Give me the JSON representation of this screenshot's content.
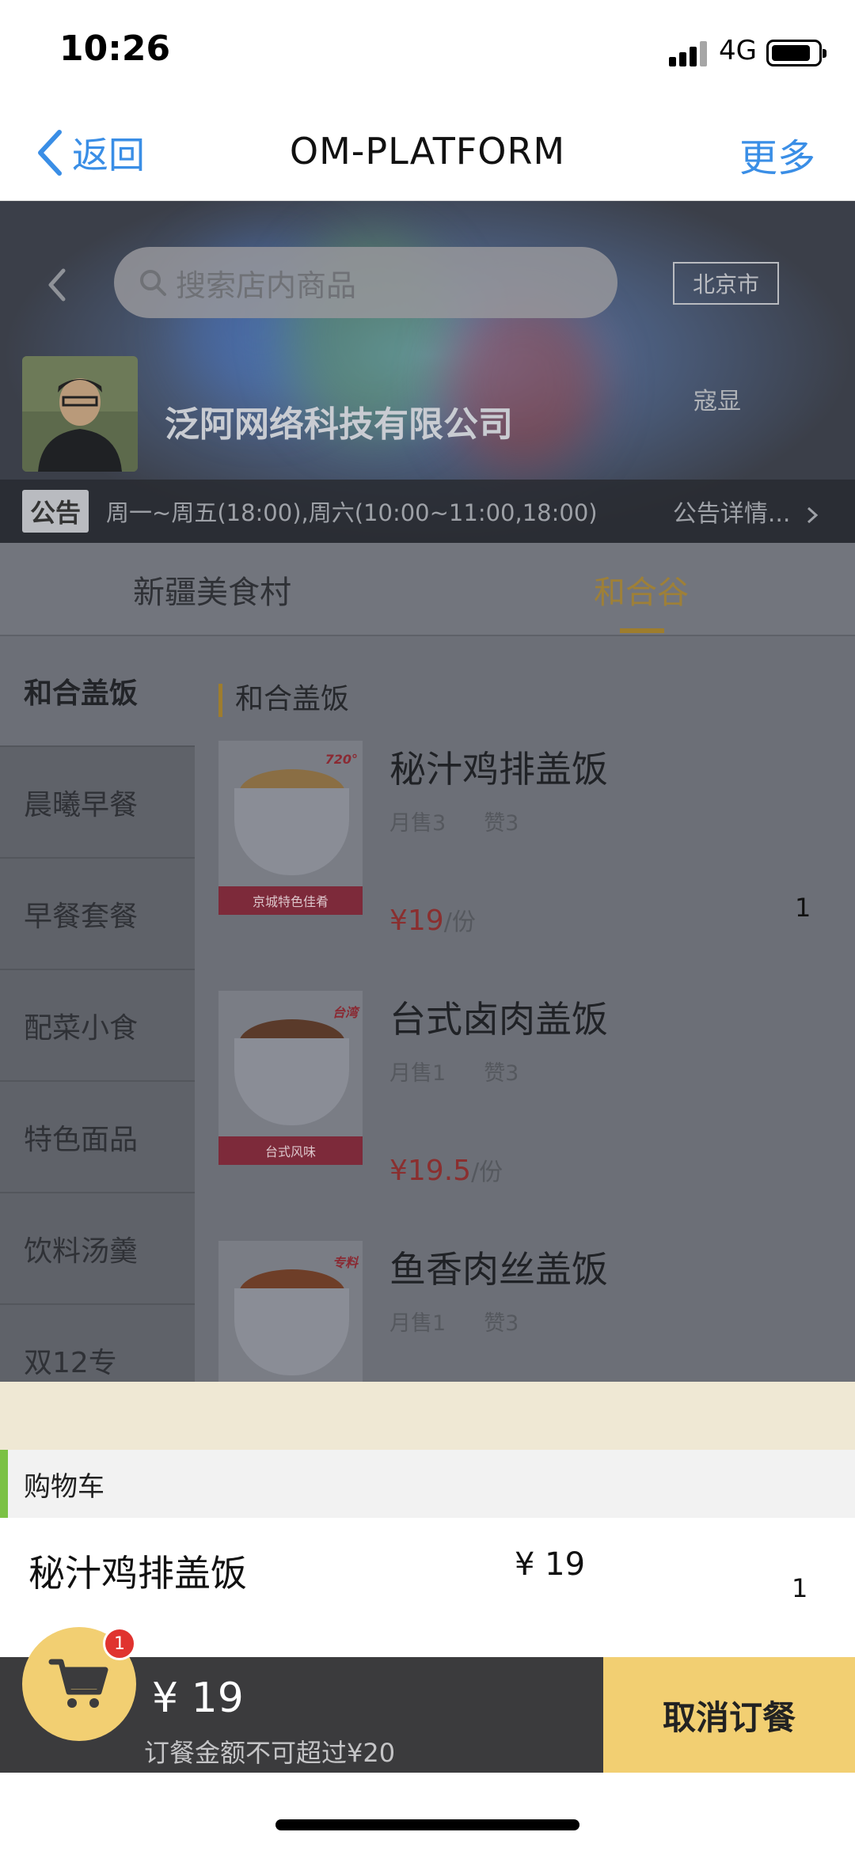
{
  "status_bar": {
    "time": "10:26",
    "network": "4G",
    "icons": [
      "signal-icon",
      "battery-icon"
    ]
  },
  "nav": {
    "back_label": "返回",
    "title": "OM-PLATFORM",
    "more_label": "更多",
    "icons": [
      "back-chevron-icon"
    ]
  },
  "shop": {
    "search_placeholder": "搜索店内商品",
    "city": "北京市",
    "name": "泛阿网络科技有限公司",
    "owner": "寇显",
    "notice_tag": "公告",
    "notice_text": "周一~周五(18:00),周六(10:00~11:00,18:00)",
    "notice_more": "公告详情...",
    "icons": [
      "back-chevron-icon",
      "search-icon",
      "chevron-right-icon",
      "avatar-photo"
    ]
  },
  "tabs": [
    {
      "label": "新疆美食村",
      "active": false
    },
    {
      "label": "和合谷",
      "active": true
    }
  ],
  "categories": [
    {
      "label": "和合盖饭",
      "active": true
    },
    {
      "label": "晨曦早餐",
      "active": false
    },
    {
      "label": "早餐套餐",
      "active": false
    },
    {
      "label": "配菜小食",
      "active": false
    },
    {
      "label": "特色面品",
      "active": false
    },
    {
      "label": "饮料汤羹",
      "active": false
    },
    {
      "label": "双12专",
      "active": false
    }
  ],
  "section_title": "和合盖饭",
  "items": [
    {
      "name": "秘汁鸡排盖饭",
      "monthly_sales": "月售3",
      "likes": "赞3",
      "price": "¥19",
      "unit": "/份",
      "qty": "1",
      "image_band": "京城特色佳肴"
    },
    {
      "name": "台式卤肉盖饭",
      "monthly_sales": "月售1",
      "likes": "赞3",
      "price": "¥19.5",
      "unit": "/份",
      "qty": "",
      "image_band": "台式风味"
    },
    {
      "name": "鱼香肉丝盖饭",
      "monthly_sales": "月售1",
      "likes": "赞3",
      "price": "",
      "unit": "",
      "qty": "",
      "image_band": ""
    }
  ],
  "cart": {
    "header": "购物车",
    "items": [
      {
        "name": "秘汁鸡排盖饭",
        "price": "¥ 19",
        "qty": "1"
      }
    ],
    "badge_count": "1",
    "total": "¥ 19",
    "limit_note": "订餐金额不可超过¥20",
    "cancel_label": "取消订餐",
    "icons": [
      "cart-icon"
    ]
  },
  "colors": {
    "accent_blue": "#3a8ee6",
    "cart_yellow": "#f2cf72",
    "badge_red": "#e0332f",
    "cart_green": "#7bc144",
    "price_red": "#8a2f2f"
  }
}
